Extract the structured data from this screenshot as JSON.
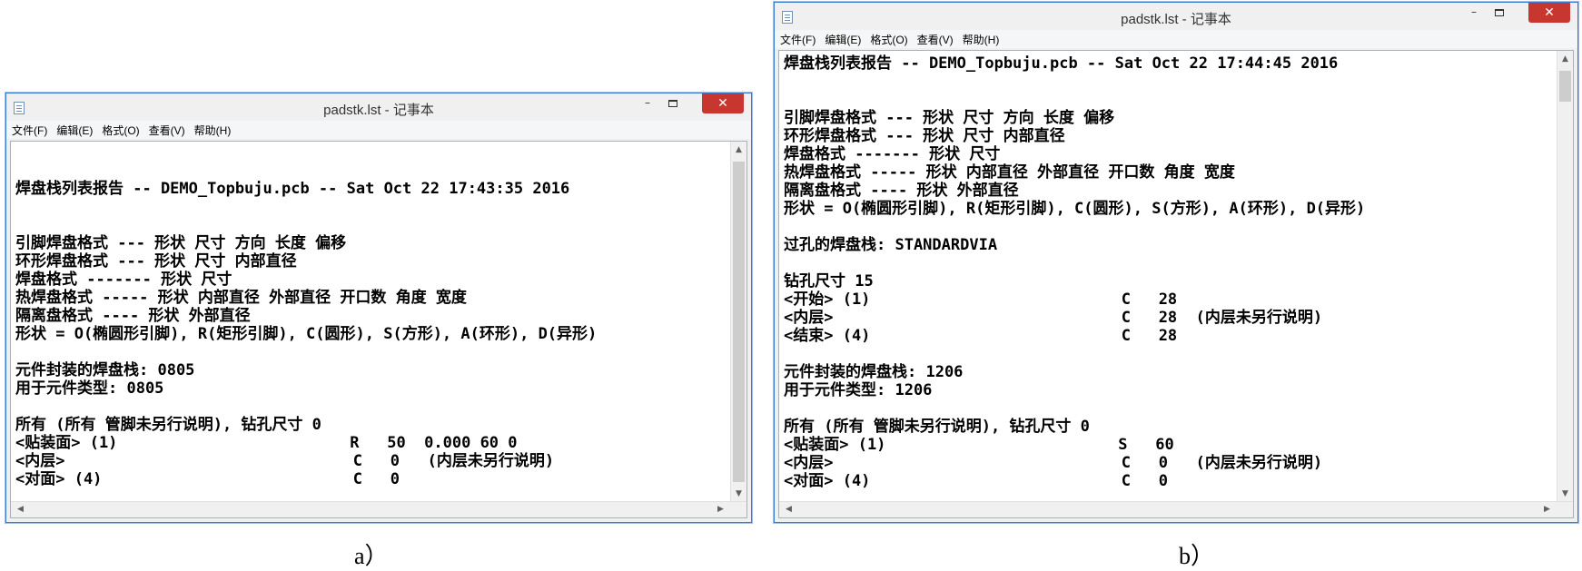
{
  "window_a": {
    "title": "padstk.lst - 记事本",
    "menu": [
      "文件(F)",
      "编辑(E)",
      "格式(O)",
      "查看(V)",
      "帮助(H)"
    ],
    "controls": {
      "minimize": "–",
      "close": "✕"
    },
    "content": "\n\n焊盘栈列表报告 -- DEMO_Topbuju.pcb -- Sat Oct 22 17:43:35 2016\n\n\n引脚焊盘格式 --- 形状 尺寸 方向 长度 偏移\n环形焊盘格式 --- 形状 尺寸 内部直径\n焊盘格式 ------- 形状 尺寸\n热焊盘格式 ----- 形状 内部直径 外部直径 开口数 角度 宽度\n隔离盘格式 ---- 形状 外部直径\n形状 = O(椭圆形引脚), R(矩形引脚), C(圆形), S(方形), A(环形), D(异形)\n\n元件封装的焊盘栈: 0805\n用于元件类型: 0805\n\n所有 (所有 管脚未另行说明), 钻孔尺寸 0\n<贴装面> (1)                         R   50  0.000 60 0\n<内层>                               C   0   (内层未另行说明)\n<对面> (4)                           C   0",
    "caption": "a）"
  },
  "window_b": {
    "title": "padstk.lst - 记事本",
    "menu": [
      "文件(F)",
      "编辑(E)",
      "格式(O)",
      "查看(V)",
      "帮助(H)"
    ],
    "controls": {
      "minimize": "–",
      "close": "✕"
    },
    "content": "焊盘栈列表报告 -- DEMO_Topbuju.pcb -- Sat Oct 22 17:44:45 2016\n\n\n引脚焊盘格式 --- 形状 尺寸 方向 长度 偏移\n环形焊盘格式 --- 形状 尺寸 内部直径\n焊盘格式 ------- 形状 尺寸\n热焊盘格式 ----- 形状 内部直径 外部直径 开口数 角度 宽度\n隔离盘格式 ---- 形状 外部直径\n形状 = O(椭圆形引脚), R(矩形引脚), C(圆形), S(方形), A(环形), D(异形)\n\n过孔的焊盘栈: STANDARDVIA\n\n钻孔尺寸 15\n<开始> (1)                           C   28\n<内层>                               C   28  (内层未另行说明)\n<结束> (4)                           C   28\n\n元件封装的焊盘栈: 1206\n用于元件类型: 1206\n\n所有 (所有 管脚未另行说明), 钻孔尺寸 0\n<贴装面> (1)                         S   60\n<内层>                               C   0   (内层未另行说明)\n<对面> (4)                           C   0",
    "caption": "b）"
  },
  "colors": {
    "close_button": "#c7372f",
    "window_border": "#3a7bd5",
    "chrome": "#f0f0f0"
  },
  "icons": {
    "app": "notepad-icon",
    "scroll_up": "chevron-up-icon",
    "scroll_down": "chevron-down-icon",
    "scroll_left": "chevron-left-icon",
    "scroll_right": "chevron-right-icon"
  }
}
